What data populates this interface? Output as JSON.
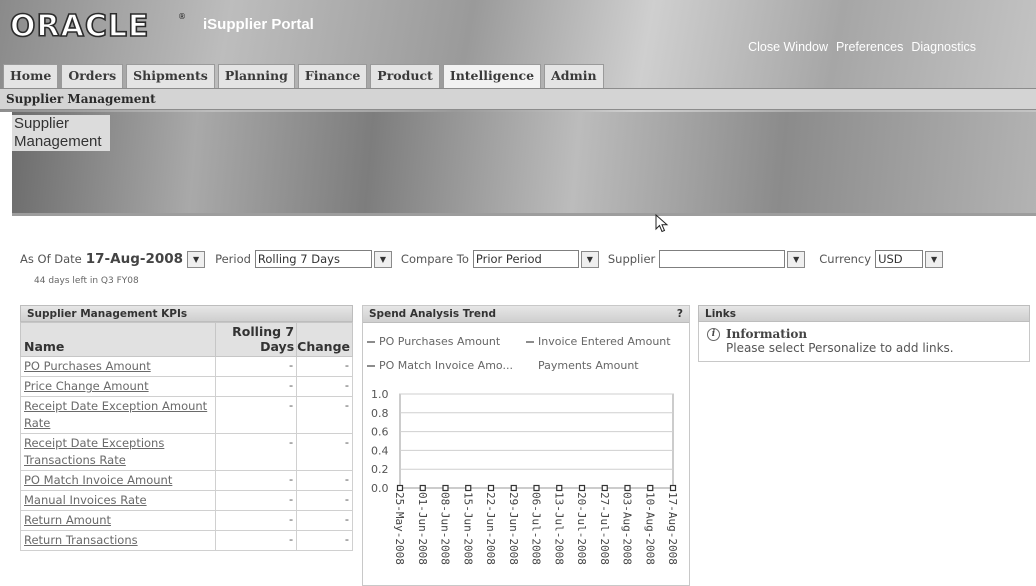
{
  "header": {
    "logo": "ORACLE",
    "logo_mark": "®",
    "app_title": "iSupplier Portal",
    "global_links": [
      "Close Window",
      "Preferences",
      "Diagnostics"
    ]
  },
  "tabs": [
    "Home",
    "Orders",
    "Shipments",
    "Planning",
    "Finance",
    "Product",
    "Intelligence",
    "Admin"
  ],
  "active_tab": "Intelligence",
  "subnav": "Supplier Management",
  "banner": {
    "title": "Supplier Management"
  },
  "params": {
    "as_of_label": "As Of Date",
    "as_of_value": "17-Aug-2008",
    "days_left": "44 days left in Q3 FY08",
    "period_label": "Period",
    "period_value": "Rolling 7 Days",
    "compare_label": "Compare To",
    "compare_value": "Prior Period",
    "supplier_label": "Supplier",
    "supplier_value": "",
    "currency_label": "Currency",
    "currency_value": "USD"
  },
  "kpi": {
    "title": "Supplier Management KPIs",
    "columns": {
      "name": "Name",
      "rolling": "Rolling 7 Days",
      "change": "Change"
    },
    "rows": [
      {
        "name": "PO Purchases Amount",
        "value": "-",
        "change": "-"
      },
      {
        "name": "Price Change Amount",
        "value": "-",
        "change": "-"
      },
      {
        "name": "Receipt Date Exception Amount Rate",
        "value": "-",
        "change": "-"
      },
      {
        "name": "Receipt Date Exceptions Transactions Rate",
        "value": "-",
        "change": "-"
      },
      {
        "name": "PO Match Invoice Amount",
        "value": "-",
        "change": "-"
      },
      {
        "name": "Manual Invoices Rate",
        "value": "-",
        "change": "-"
      },
      {
        "name": "Return Amount",
        "value": "-",
        "change": "-"
      },
      {
        "name": "Return Transactions",
        "value": "-",
        "change": "-"
      }
    ]
  },
  "spend": {
    "title": "Spend Analysis Trend",
    "help": "?",
    "colors": {
      "po": "#8c8c8c",
      "invoice": "#8c8c8c",
      "match": "#8c8c8c",
      "payments": "#ffffff"
    }
  },
  "chart_data": {
    "type": "line",
    "title": "",
    "xlabel": "",
    "ylabel": "",
    "ylim": [
      0.0,
      1.0
    ],
    "yticks": [
      "1.0",
      "0.8",
      "0.6",
      "0.4",
      "0.2",
      "0.0"
    ],
    "categories": [
      "25-May-2008",
      "01-Jun-2008",
      "08-Jun-2008",
      "15-Jun-2008",
      "22-Jun-2008",
      "29-Jun-2008",
      "06-Jul-2008",
      "13-Jul-2008",
      "20-Jul-2008",
      "27-Jul-2008",
      "03-Aug-2008",
      "10-Aug-2008",
      "17-Aug-2008"
    ],
    "series": [
      {
        "name": "PO Purchases Amount",
        "values": [
          0,
          0,
          0,
          0,
          0,
          0,
          0,
          0,
          0,
          0,
          0,
          0,
          0
        ]
      },
      {
        "name": "Invoice Entered Amount",
        "values": [
          0,
          0,
          0,
          0,
          0,
          0,
          0,
          0,
          0,
          0,
          0,
          0,
          0
        ]
      },
      {
        "name": "PO Match Invoice Amo...",
        "values": [
          0,
          0,
          0,
          0,
          0,
          0,
          0,
          0,
          0,
          0,
          0,
          0,
          0
        ]
      },
      {
        "name": "Payments Amount",
        "values": [
          0,
          0,
          0,
          0,
          0,
          0,
          0,
          0,
          0,
          0,
          0,
          0,
          0
        ]
      }
    ],
    "grid": true,
    "legend": "top"
  },
  "links": {
    "title": "Links",
    "info_title": "Information",
    "info_text": "Please select Personalize to add links."
  }
}
